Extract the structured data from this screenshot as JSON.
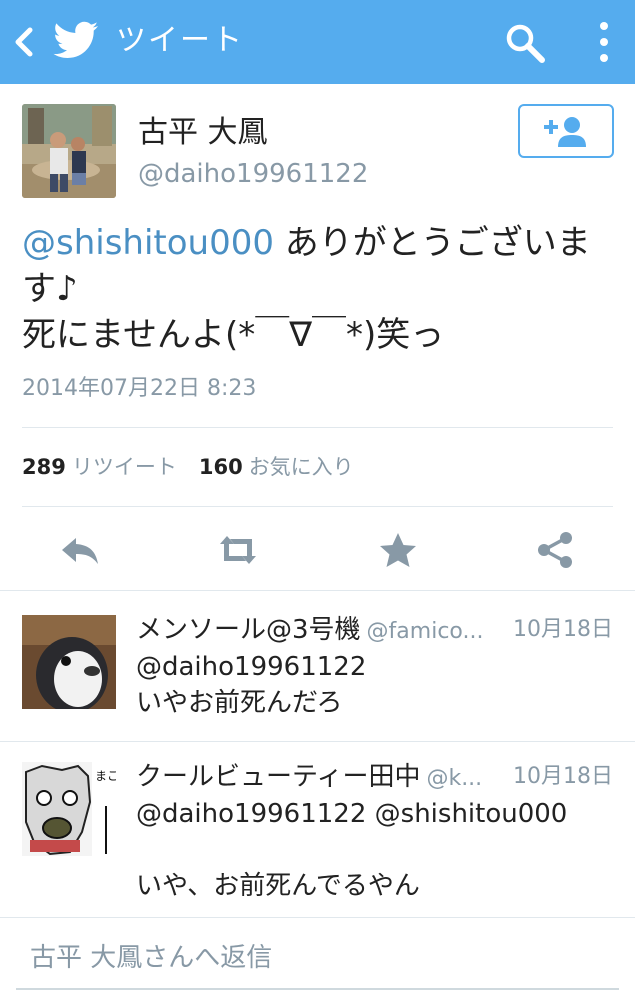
{
  "header": {
    "title": "ツイート",
    "bg_color": "#55acee"
  },
  "tweet": {
    "author_name": "古平 大鳳",
    "author_handle": "@daiho19961122",
    "mention": "@shishitou000",
    "text_line1_rest": " ありがとうございま",
    "text_line2": "す♪",
    "text_line3": "死にませんよ(*￣∇￣*)笑っ",
    "timestamp": "2014年07月22日 8:23",
    "retweet_count": "289",
    "retweet_label": "リツイート",
    "favorite_count": "160",
    "favorite_label": "お気に入り"
  },
  "actions": {
    "icons": [
      "reply-icon",
      "retweet-icon",
      "favorite-star-icon",
      "share-icon"
    ],
    "color": "#8899a6"
  },
  "replies": [
    {
      "name": "メンソール@3号機",
      "handle": "@famico...",
      "time": "10月18日",
      "line1": "@daiho19961122",
      "line2": "いやお前死んだろ"
    },
    {
      "name": "クールビューティー田中",
      "handle": "@k...",
      "time": "10月18日",
      "line1": "@daiho19961122 @shishitou000",
      "line2": "いや、お前死んでるやん",
      "avatar_text": "まこ"
    }
  ],
  "compose": {
    "placeholder": "古平 大鳳さんへ返信"
  }
}
